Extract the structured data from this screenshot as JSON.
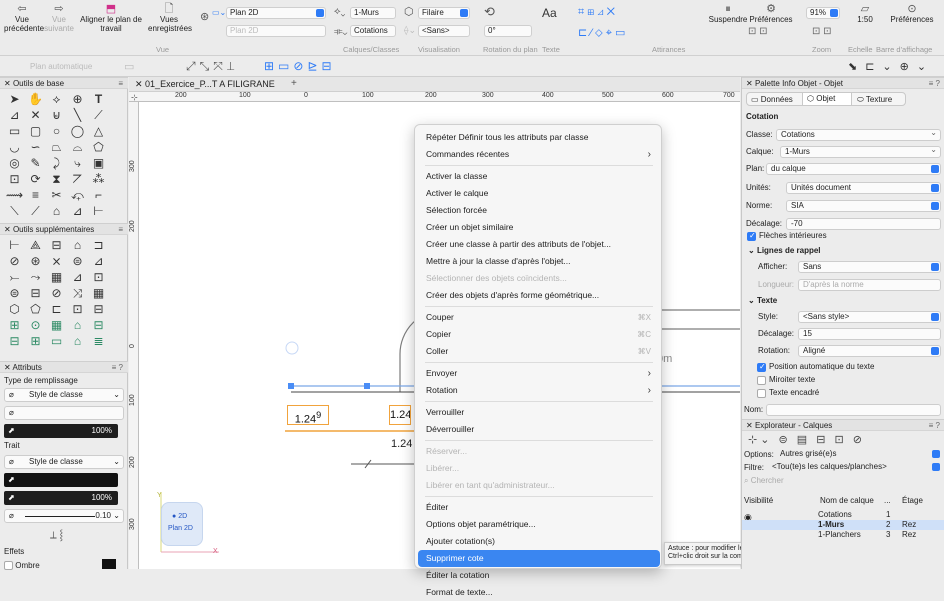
{
  "toolbar": {
    "vue_precedente": "Vue précédente",
    "vue_suivante": "Vue suivante",
    "aligner": "Aligner le plan de travail",
    "vues_enregistrees": "Vues enregistrées",
    "plan2d": "Plan 2D",
    "plan2d_dim": "Plan 2D",
    "layer": "1-Murs",
    "class": "Cotations",
    "render": "Filaire",
    "sans": "<Sans>",
    "rotation_value": "0°",
    "texte_icon": "Aa",
    "suspendre": "Suspendre",
    "preferences": "Préférences",
    "zoom": "91%",
    "echelle": "1:50",
    "preferences2": "Préférences",
    "groups": {
      "vue": "Vue",
      "calques": "Calques/Classes",
      "visualisation": "Visualisation",
      "rotation": "Rotation du plan",
      "texte": "Texte",
      "attirances": "Attirances",
      "zoom": "Zoom",
      "echelle": "Echelle",
      "barre": "Barre d'affichage"
    },
    "plan_auto": "Plan automatique"
  },
  "left": {
    "outils_base": "Outils de base",
    "outils_supp": "Outils supplémentaires",
    "attributs": "Attributs",
    "type_remplissage": "Type de remplissage",
    "style_classe": "Style de classe",
    "pct": "100%",
    "trait": "Trait",
    "style_classe2": "Style de classe",
    "pct2": "100%",
    "epaisseur": "0.10",
    "effets": "Effets",
    "ombre": "Ombre"
  },
  "doc": {
    "tab": "01_Exercice_P...T A FILIGRANE",
    "ruler_top": [
      "200",
      "100",
      "0",
      "100",
      "200",
      "300",
      "400",
      "500",
      "600",
      "700"
    ],
    "ruler_left": [
      "300",
      "200",
      "0",
      "100",
      "200",
      "300"
    ],
    "dim1": "1.24",
    "dim1_sup": "9",
    "dim2": "1.24",
    "dim3": "1.24",
    "plan2d_badge_label": "2D",
    "plan2d_badge": "Plan 2D",
    "dim_partial": "0m",
    "axis_y": "Y",
    "axis_x": "X"
  },
  "menu": [
    {
      "label": "Répéter Définir tous les attributs par classe"
    },
    {
      "label": "Commandes récentes",
      "arrow": "›"
    },
    {
      "label": "Activer la classe"
    },
    {
      "label": "Activer le calque"
    },
    {
      "label": "Sélection forcée"
    },
    {
      "label": "Créer un objet similaire"
    },
    {
      "label": "Créer une classe à partir des attributs de l'objet..."
    },
    {
      "label": "Mettre à jour la classe d'après l'objet..."
    },
    {
      "label": "Sélectionner des objets coïncidents...",
      "disabled": true
    },
    {
      "label": "Créer des objets d'après forme géométrique..."
    },
    {
      "label": "Couper",
      "shortcut": "⌘X"
    },
    {
      "label": "Copier",
      "shortcut": "⌘C"
    },
    {
      "label": "Coller",
      "shortcut": "⌘V"
    },
    {
      "label": "Envoyer",
      "arrow": "›"
    },
    {
      "label": "Rotation",
      "arrow": "›"
    },
    {
      "label": "Verrouiller"
    },
    {
      "label": "Déverrouiller"
    },
    {
      "label": "Réserver...",
      "disabled": true
    },
    {
      "label": "Libérer...",
      "disabled": true
    },
    {
      "label": "Libérer en tant qu'administrateur...",
      "disabled": true
    },
    {
      "label": "Éditer"
    },
    {
      "label": "Options objet paramétrique..."
    },
    {
      "label": "Ajouter cotation(s)"
    },
    {
      "label": "Supprimer cote",
      "highlighted": true
    },
    {
      "label": "Éditer la cotation"
    },
    {
      "label": "Format de texte..."
    }
  ],
  "tooltip": "Astuce : pour modifier le raccourci, faites Ctrl+clic droit sur la commande.",
  "right": {
    "palette_title": "Palette Info Objet - Objet",
    "tab_donnees": "Données",
    "tab_objet": "Objet",
    "tab_texture": "Texture",
    "section": "Cotation",
    "classe_label": "Classe:",
    "classe": "Cotations",
    "calque_label": "Calque:",
    "calque": "1-Murs",
    "plan_label": "Plan:",
    "plan": "du calque",
    "unites_label": "Unités:",
    "unites": "Unités document",
    "norme_label": "Norme:",
    "norme": "SIA",
    "decalage_label": "Décalage:",
    "decalage": "-70",
    "fleches": "Flèches intérieures",
    "lignes_rappel": "Lignes de rappel",
    "afficher_label": "Afficher:",
    "afficher": "Sans",
    "longueur_label": "Longueur:",
    "longueur": "D'après la norme",
    "texte": "Texte",
    "style_label": "Style:",
    "style": "<Sans style>",
    "decalage2_label": "Décalage:",
    "decalage2": "15",
    "rotation_label": "Rotation:",
    "rotation": "Aligné",
    "position_auto": "Position automatique du texte",
    "miroiter": "Miroiter texte",
    "encadre": "Texte encadré",
    "nom_label": "Nom:",
    "explorer_title": "Explorateur - Calques",
    "options_label": "Options:",
    "options": "Autres grisé(e)s",
    "filtre_label": "Filtre:",
    "filtre": "<Tou(te)s les calques/planches>",
    "chercher": "Chercher",
    "col_visibilite": "Visibilité",
    "col_nom": "Nom de calque",
    "col_dots": "...",
    "col_etage": "Étage",
    "layers": [
      {
        "name": "Cotations",
        "num": "1",
        "etage": ""
      },
      {
        "name": "1-Murs",
        "num": "2",
        "etage": "Rez"
      },
      {
        "name": "1-Planchers",
        "num": "3",
        "etage": "Rez"
      }
    ]
  }
}
